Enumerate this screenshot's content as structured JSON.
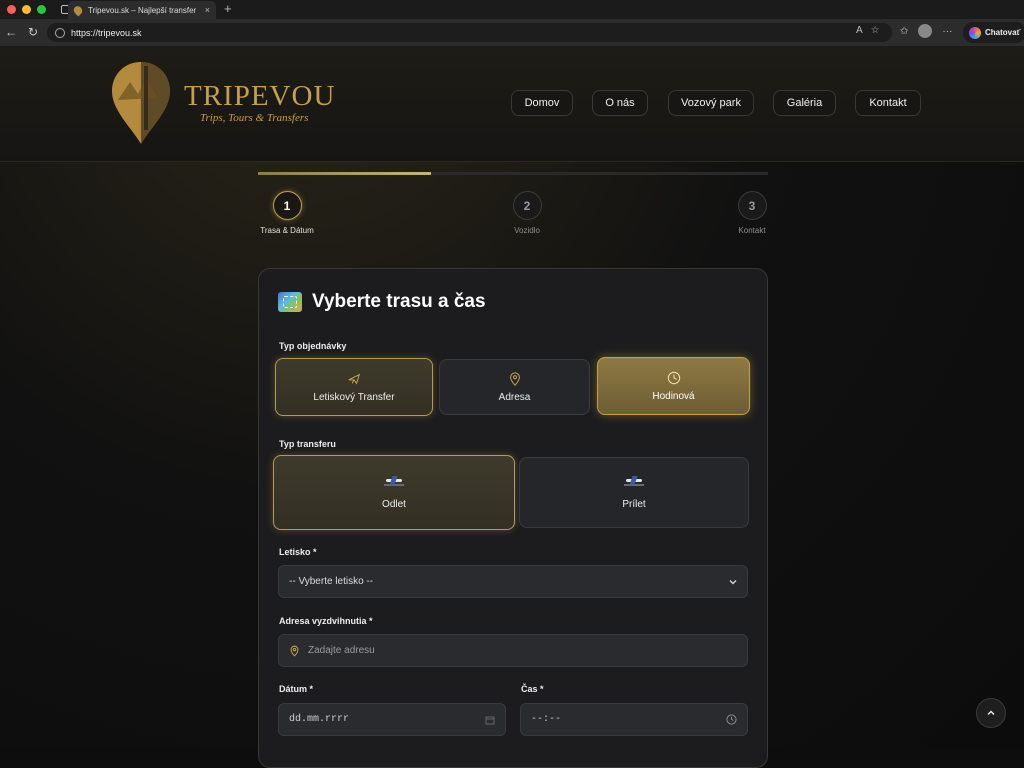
{
  "browser": {
    "tab_title": "Tripevou.sk – Najlepší transfer",
    "tab_close": "×",
    "new_tab": "+",
    "url": "https://tripevou.sk",
    "copilot_label": "Chatovať"
  },
  "site": {
    "logo_title": "TRIPEVOU",
    "logo_subtitle": "Trips, Tours & Transfers",
    "nav": [
      "Domov",
      "O nás",
      "Vozový park",
      "Galéria",
      "Kontakt"
    ]
  },
  "stepper": {
    "progress": 0.34,
    "steps": [
      {
        "num": "1",
        "label": "Trasa & Dátum"
      },
      {
        "num": "2",
        "label": "Vozidlo"
      },
      {
        "num": "3",
        "label": "Kontakt"
      }
    ]
  },
  "form": {
    "title": "Vyberte trasu a čas",
    "order_type_label": "Typ objednávky",
    "order_types": [
      "Letiskový Transfer",
      "Adresa",
      "Hodinová"
    ],
    "transfer_type_label": "Typ transferu",
    "transfer_types": [
      "Odlet",
      "Prílet"
    ],
    "airport_label": "Letisko *",
    "airport_value": "-- Vyberte letisko --",
    "pickup_label": "Adresa vyzdvihnutia *",
    "pickup_placeholder": "Zadajte adresu",
    "date_label": "Dátum *",
    "date_value": "dd.mm.rrrr",
    "time_label": "Čas *",
    "time_value": "--:--"
  },
  "colors": {
    "accent_gold": "#c6a049",
    "card_bg": "#1c1c1e"
  }
}
